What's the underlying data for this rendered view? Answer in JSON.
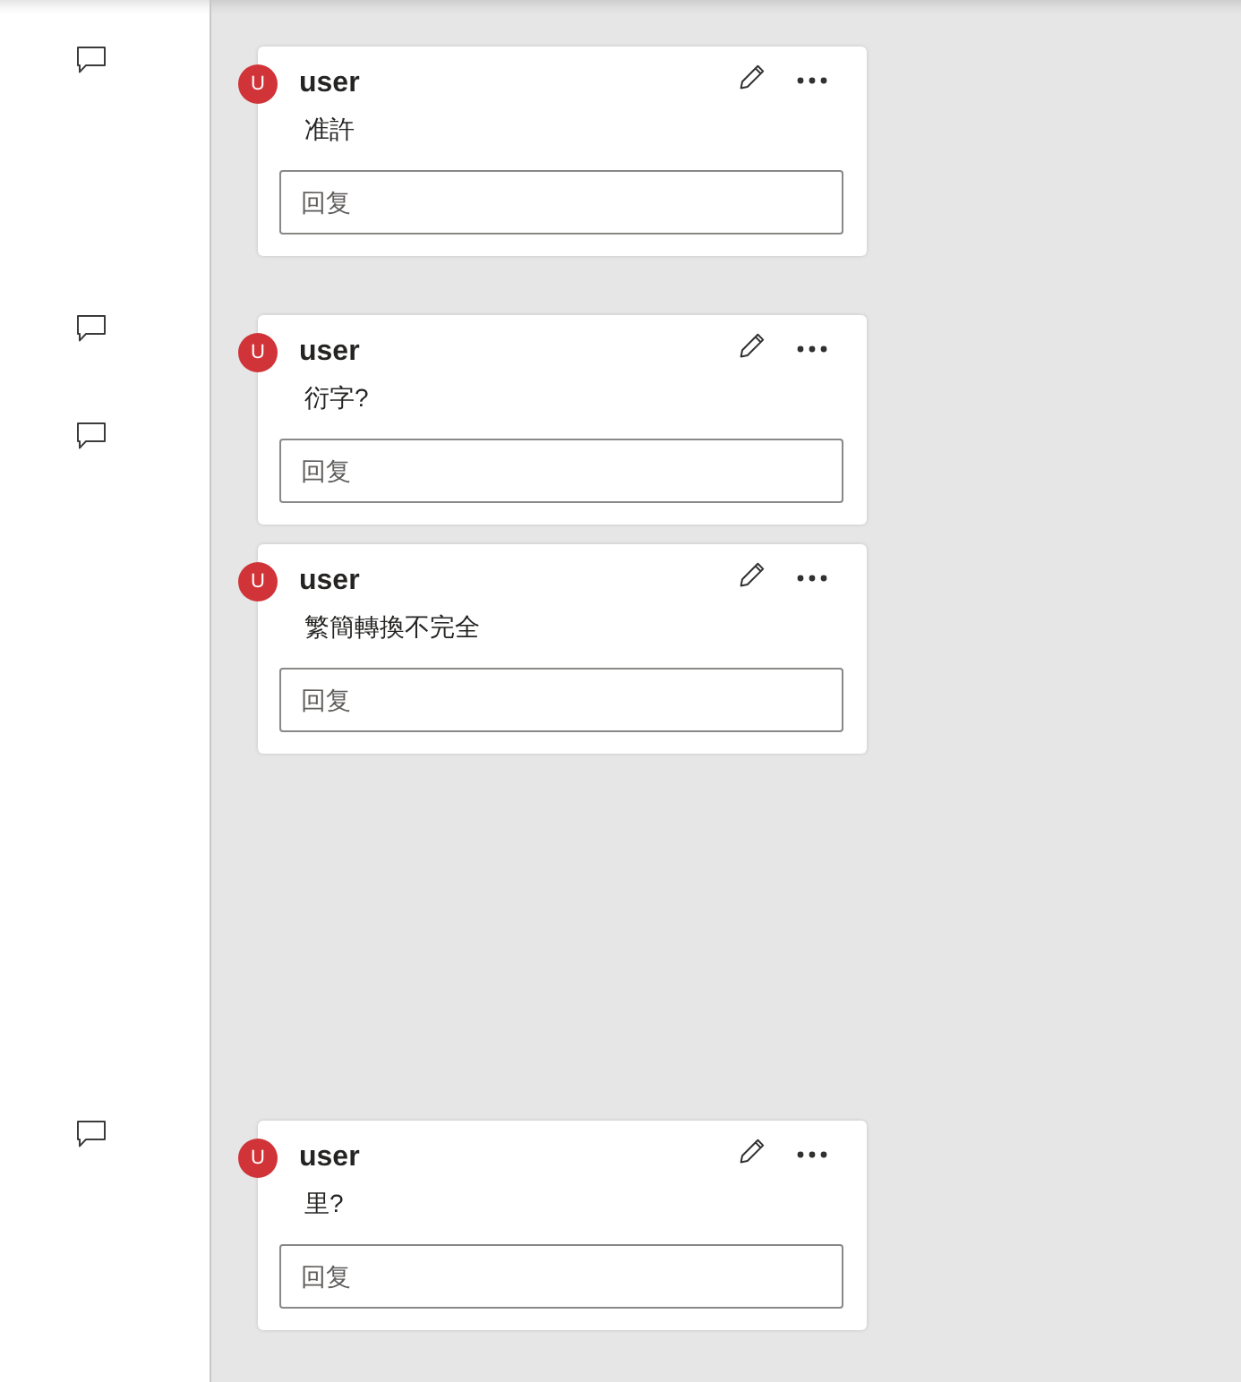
{
  "comments": [
    {
      "author": "user",
      "initial": "U",
      "text": "准許",
      "reply": {
        "placeholder": "回复"
      }
    },
    {
      "author": "user",
      "initial": "U",
      "text": "衍字?",
      "reply": {
        "placeholder": "回复"
      }
    },
    {
      "author": "user",
      "initial": "U",
      "text": "繁簡轉換不完全",
      "reply": {
        "placeholder": "回复"
      }
    },
    {
      "author": "user",
      "initial": "U",
      "text": "里?",
      "reply": {
        "placeholder": "回复"
      }
    }
  ]
}
